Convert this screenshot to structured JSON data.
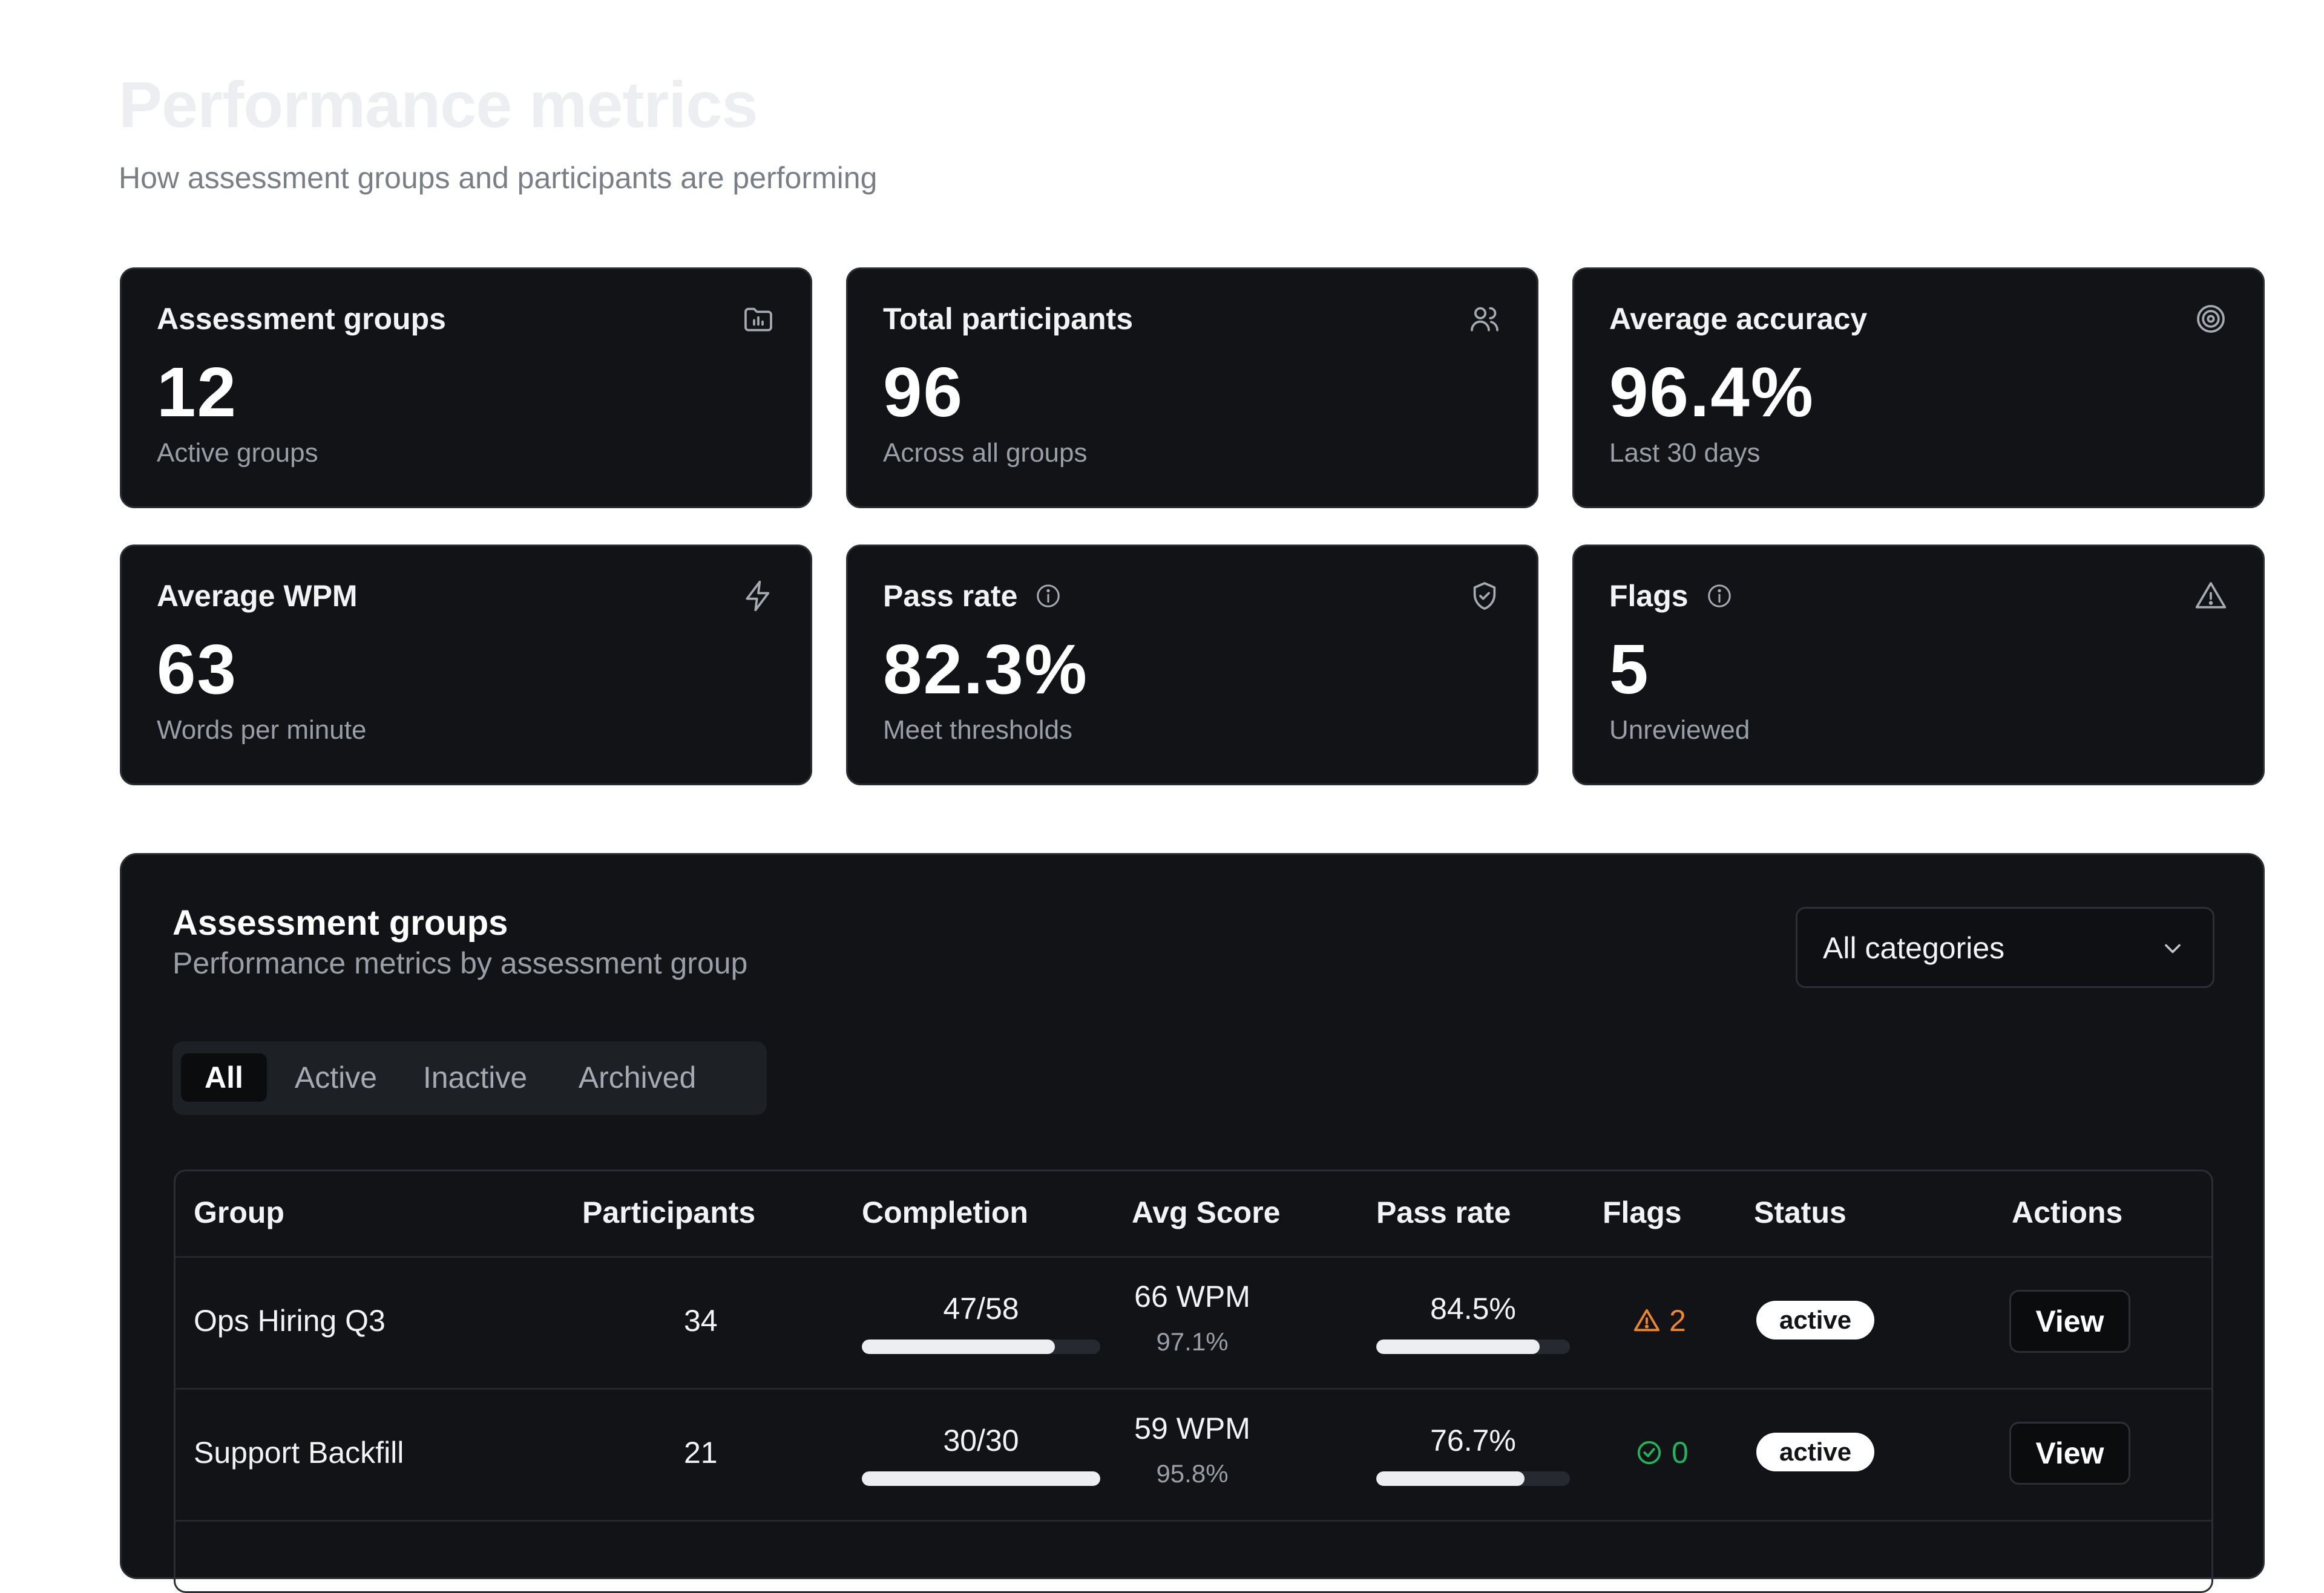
{
  "header": {
    "title": "Performance metrics",
    "subtitle": "How assessment groups and participants are performing"
  },
  "cards": [
    {
      "title": "Assessment groups",
      "value": "12",
      "sub": "Active groups",
      "icon": "folder-chart-icon"
    },
    {
      "title": "Total participants",
      "value": "96",
      "sub": "Across all groups",
      "icon": "users-icon"
    },
    {
      "title": "Average accuracy",
      "value": "96.4%",
      "sub": "Last 30 days",
      "icon": "target-icon"
    },
    {
      "title": "Average WPM",
      "value": "63",
      "sub": "Words per minute",
      "icon": "lightning-icon"
    },
    {
      "title": "Pass rate",
      "value": "82.3%",
      "sub": "Meet thresholds",
      "icon": "shield-check-icon"
    },
    {
      "title": "Flags",
      "value": "5",
      "sub": "Unreviewed",
      "icon": "warning-triangle-icon"
    }
  ],
  "panel": {
    "title": "Assessment groups",
    "subtitle": "Performance metrics by assessment group",
    "filter": {
      "selected": "All categories"
    },
    "tabs": [
      "All",
      "Active",
      "Inactive",
      "Archived"
    ],
    "active_tab": "All",
    "columns": [
      "Group",
      "Participants",
      "Completion",
      "Avg Score",
      "Pass rate",
      "Flags",
      "Status",
      "Actions"
    ],
    "rows": [
      {
        "group": "Ops Hiring Q3",
        "participants": "34",
        "completion": "47/58",
        "completion_frac": 0.81,
        "avg_wpm": "66 WPM",
        "avg_acc": "97.1%",
        "pass_rate": "84.5%",
        "pass_frac": 0.845,
        "flags": "2",
        "flag_type": "warning",
        "status": "active",
        "action": "View"
      },
      {
        "group": "Support Backfill",
        "participants": "21",
        "completion": "30/30",
        "completion_frac": 1.0,
        "avg_wpm": "59 WPM",
        "avg_acc": "95.8%",
        "pass_rate": "76.7%",
        "pass_frac": 0.767,
        "flags": "0",
        "flag_type": "ok",
        "status": "active",
        "action": "View"
      }
    ]
  },
  "colors": {
    "card_bg": "#111316",
    "warning": "#f0862a",
    "ok": "#22b45a"
  }
}
